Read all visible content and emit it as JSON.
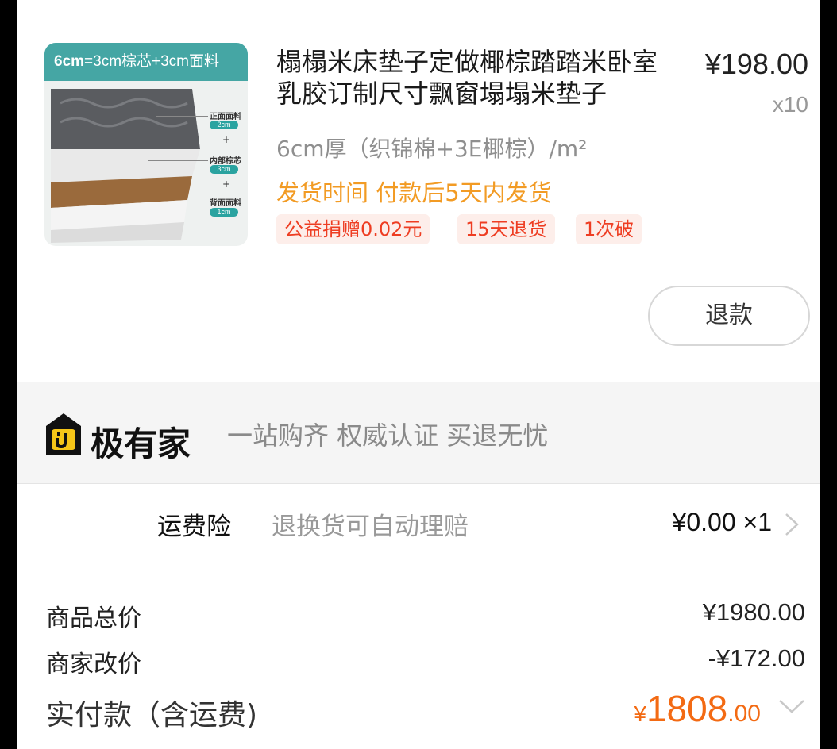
{
  "product": {
    "image_caption_strong": "6cm",
    "image_caption_rest": "=3cm棕芯+3cm面料",
    "image_layers": [
      {
        "label": "正面面料",
        "size": "2cm"
      },
      {
        "label": "内部棕芯",
        "size": "3cm"
      },
      {
        "label": "背面面料",
        "size": "1cm"
      }
    ],
    "image_plus": "+",
    "title": "榻榻米床垫子定做椰棕踏踏米卧室乳胶订制尺寸飘窗塌塌米垫子",
    "price": "¥198.00",
    "quantity": "x10",
    "spec": "6cm厚（织锦棉+3E椰棕）/m²",
    "shipping": "发货时间 付款后5天内发货",
    "tags": [
      "公益捐赠0.02元",
      "15天退货",
      "1次破"
    ],
    "refund_button": "退款"
  },
  "banner": {
    "logo_text": "极有家",
    "slogan": "一站购齐 权威认证 买退无忧"
  },
  "insurance": {
    "label": "运费险",
    "description": "退换货可自动理赔",
    "price": "¥0.00 ×1"
  },
  "summary": {
    "rows": [
      {
        "label": "商品总价",
        "value": "¥1980.00"
      },
      {
        "label": "商家改价",
        "value": "-¥172.00"
      }
    ],
    "paid_label": "实付款（含运费)",
    "paid_currency": "¥",
    "paid_int": "1808",
    "paid_dec": ".00"
  },
  "colors": {
    "accent_orange": "#f36a13",
    "shipping_orange": "#f29b24",
    "tag_red": "#ee3d22",
    "teal": "#45a6a4",
    "logo_yellow": "#f5c518"
  }
}
